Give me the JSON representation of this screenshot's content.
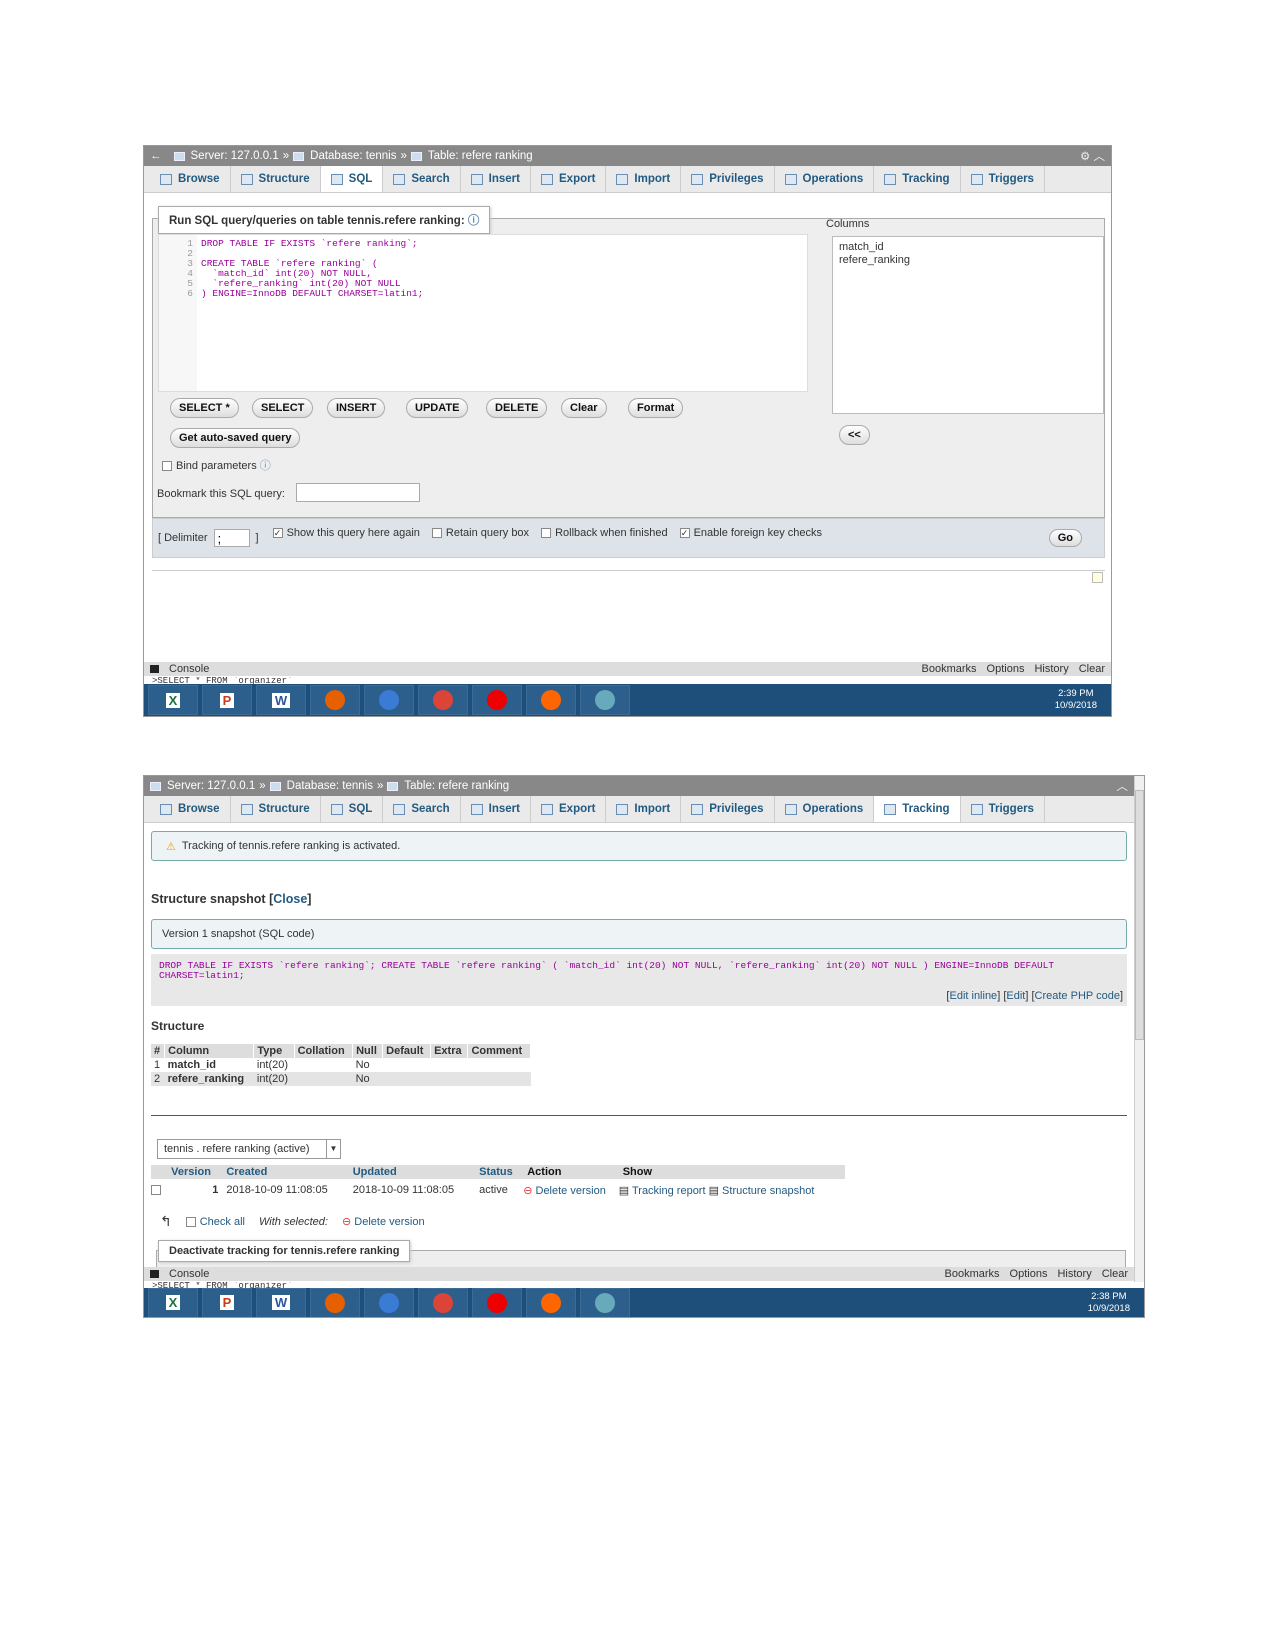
{
  "screenshot1": {
    "breadcrumb": {
      "server": "Server: 127.0.0.1",
      "sep": "»",
      "database": "Database: tennis",
      "table": "Table: refere ranking"
    },
    "tabs": [
      "Browse",
      "Structure",
      "SQL",
      "Search",
      "Insert",
      "Export",
      "Import",
      "Privileges",
      "Operations",
      "Tracking",
      "Triggers"
    ],
    "active_tab": "SQL",
    "legend": "Run SQL query/queries on table tennis.refere ranking:",
    "line_numbers": [
      "1",
      "2",
      "3",
      "4",
      "5",
      "6"
    ],
    "sql_lines": [
      "DROP TABLE IF EXISTS `refere ranking`;",
      "",
      "CREATE TABLE `refere ranking` (",
      "  `match_id` int(20) NOT NULL,",
      "  `refere_ranking` int(20) NOT NULL",
      ") ENGINE=InnoDB DEFAULT CHARSET=latin1;"
    ],
    "query_buttons": [
      "SELECT *",
      "SELECT",
      "INSERT",
      "UPDATE",
      "DELETE",
      "Clear",
      "Format"
    ],
    "autosaved_button": "Get auto-saved query",
    "bind_parameters": "Bind parameters",
    "bookmark_label": "Bookmark this SQL query:",
    "bookmark_value": "",
    "columns_label": "Columns",
    "columns": [
      "match_id",
      "refere_ranking"
    ],
    "insert_button": "<<",
    "delimiter_label": "[ Delimiter",
    "delimiter_value": ";",
    "delimiter_close": "]",
    "options": [
      {
        "label": "Show this query here again",
        "checked": true
      },
      {
        "label": "Retain query box",
        "checked": false
      },
      {
        "label": "Rollback when finished",
        "checked": false
      },
      {
        "label": "Enable foreign key checks",
        "checked": true
      }
    ],
    "go_button": "Go",
    "console": {
      "label": "Console",
      "links": [
        "Bookmarks",
        "Options",
        "History",
        "Clear"
      ],
      "preview": ">SELECT * FROM `organizer`"
    },
    "taskbar": {
      "time": "2:39 PM",
      "date": "10/9/2018"
    }
  },
  "screenshot2": {
    "breadcrumb": {
      "server": "Server: 127.0.0.1",
      "sep": "»",
      "database": "Database: tennis",
      "table": "Table: refere ranking"
    },
    "tabs": [
      "Browse",
      "Structure",
      "SQL",
      "Search",
      "Insert",
      "Export",
      "Import",
      "Privileges",
      "Operations",
      "Tracking",
      "Triggers"
    ],
    "active_tab": "Tracking",
    "notice": "Tracking of tennis.refere ranking is activated.",
    "snapshot_heading": "Structure snapshot",
    "close_link": "Close",
    "version_label": "Version 1 snapshot (SQL code)",
    "snapshot_sql": "DROP TABLE IF EXISTS `refere ranking`; CREATE TABLE `refere ranking` ( `match_id` int(20) NOT NULL, `refere_ranking` int(20) NOT NULL ) ENGINE=InnoDB DEFAULT CHARSET=latin1;",
    "sql_links": [
      "Edit inline",
      "Edit",
      "Create PHP code"
    ],
    "structure_heading": "Structure",
    "structure_headers": [
      "#",
      "Column",
      "Type",
      "Collation",
      "Null",
      "Default",
      "Extra",
      "Comment"
    ],
    "structure_rows": [
      [
        "1",
        "match_id",
        "int(20)",
        "",
        "No",
        "",
        "",
        ""
      ],
      [
        "2",
        "refere_ranking",
        "int(20)",
        "",
        "No",
        "",
        "",
        ""
      ]
    ],
    "table_select": "tennis . refere ranking (active)",
    "versions_headers": [
      "",
      "Version",
      "Created",
      "Updated",
      "Status",
      "Action",
      "Show"
    ],
    "versions_rows": [
      {
        "version": "1",
        "created": "2018-10-09 11:08:05",
        "updated": "2018-10-09 11:08:05",
        "status": "active",
        "action": "Delete version",
        "show": [
          "Tracking report",
          "Structure snapshot"
        ]
      }
    ],
    "check_all": "Check all",
    "with_selected": "With selected:",
    "bulk_delete": "Delete version",
    "deactivate_legend": "Deactivate tracking for tennis.refere ranking",
    "console": {
      "label": "Console",
      "links": [
        "Bookmarks",
        "Options",
        "History",
        "Clear"
      ],
      "preview": ">SELECT * FROM `organizer`"
    },
    "taskbar": {
      "time": "2:38 PM",
      "date": "10/9/2018"
    }
  },
  "taskbar_apps": [
    "X",
    "P",
    "W",
    "firefox",
    "thunderbird",
    "chrome",
    "opera",
    "xampp",
    "photos"
  ]
}
